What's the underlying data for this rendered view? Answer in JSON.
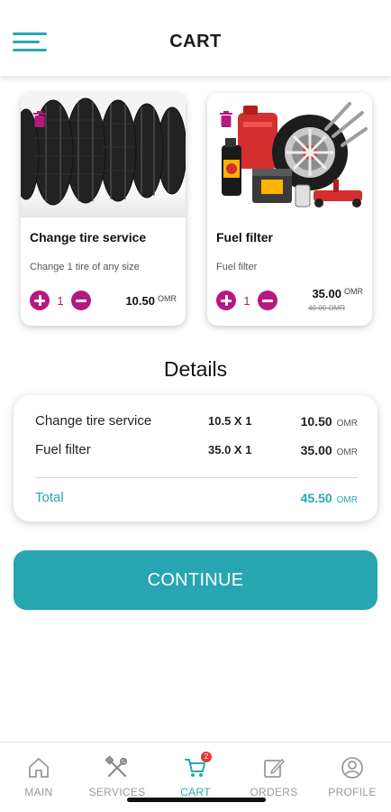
{
  "header": {
    "title": "CART",
    "menu_icon": "hamburger-menu-icon"
  },
  "cart_items": [
    {
      "title": "Change tire service",
      "description": "Change 1 tire of any size",
      "quantity": "1",
      "price": "10.50",
      "currency": "OMR",
      "image_icon": "tires-image",
      "delete_icon": "trash-icon"
    },
    {
      "title": "Fuel filter",
      "description": "Fuel filter",
      "quantity": "1",
      "price": "35.00",
      "currency": "OMR",
      "old_price": "40.00 OMR",
      "image_icon": "auto-parts-image",
      "delete_icon": "trash-icon"
    }
  ],
  "details": {
    "title": "Details",
    "rows": [
      {
        "name": "Change tire service",
        "qty": "10.5 X 1",
        "amount": "10.50",
        "currency": "OMR"
      },
      {
        "name": "Fuel filter",
        "qty": "35.0 X 1",
        "amount": "35.00",
        "currency": "OMR"
      }
    ],
    "total": {
      "label": "Total",
      "amount": "45.50",
      "currency": "OMR"
    }
  },
  "continue_label": "CONTINUE",
  "nav": {
    "items": [
      {
        "label": "MAIN",
        "icon": "home-icon"
      },
      {
        "label": "SERVICES",
        "icon": "tools-icon"
      },
      {
        "label": "CART",
        "icon": "cart-icon",
        "badge": "2",
        "active": true
      },
      {
        "label": "ORDERS",
        "icon": "edit-icon"
      },
      {
        "label": "PROFILE",
        "icon": "profile-icon"
      }
    ]
  },
  "colors": {
    "accent": "#2aa7b2",
    "magenta": "#b5197e",
    "badge": "#e53935"
  }
}
